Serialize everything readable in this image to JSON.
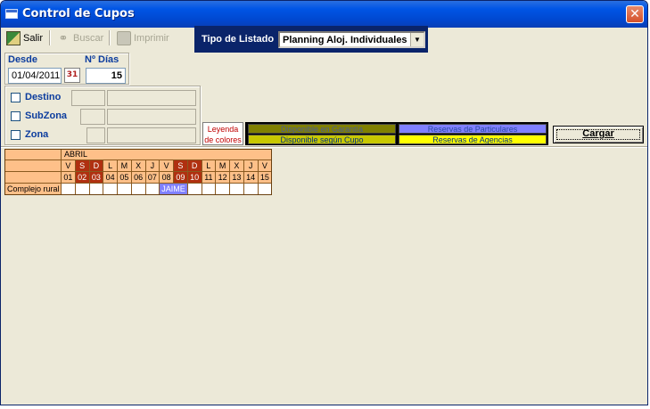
{
  "window": {
    "title": "Control de Cupos",
    "close_label": "✕"
  },
  "toolbar": {
    "salir_label": "Salir",
    "buscar_label": "Buscar",
    "imprimir_label": "Imprimir"
  },
  "tipo_listado": {
    "label": "Tipo de Listado",
    "selected": "Planning Aloj. Individuales"
  },
  "filters": {
    "desde_label": "Desde",
    "ndias_label": "Nº Días",
    "desde_value": "01/04/2011",
    "cal_icon_text": "31",
    "ndias_value": "15",
    "destino_label": "Destino",
    "subzona_label": "SubZona",
    "zona_label": "Zona"
  },
  "legend": {
    "title_line1": "Leyenda",
    "title_line2": "de colores",
    "items": [
      {
        "label": "Disponible en Garantía",
        "color": "#808000"
      },
      {
        "label": "Reservas de Particulares",
        "color": "#8080ff"
      },
      {
        "label": "Disponible según Cupo",
        "color": "#c8c800"
      },
      {
        "label": "Reservas de Agencias",
        "color": "#ffff00"
      }
    ]
  },
  "cargar_label": "Cargar",
  "colors": {
    "header_orange": "#fec089",
    "weekend_red": "#b03010",
    "booking_blue": "#8080ff"
  },
  "planning": {
    "month": "ABRIL",
    "weekdays": [
      "V",
      "S",
      "D",
      "L",
      "M",
      "X",
      "J",
      "V",
      "S",
      "D",
      "L",
      "M",
      "X",
      "J",
      "V"
    ],
    "days": [
      "01",
      "02",
      "03",
      "04",
      "05",
      "06",
      "07",
      "08",
      "09",
      "10",
      "11",
      "12",
      "13",
      "14",
      "15"
    ],
    "weekend_index": [
      1,
      2,
      8,
      9
    ],
    "rows": [
      {
        "label": "Complejo rural",
        "booking": {
          "name": "JAIME",
          "start": 7,
          "length": 2
        }
      }
    ]
  }
}
